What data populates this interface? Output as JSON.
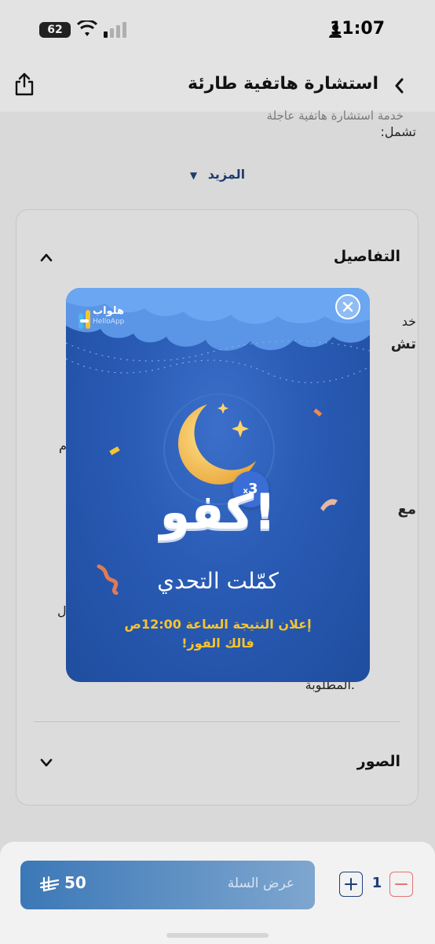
{
  "status_bar": {
    "time": "11:07",
    "battery": "62"
  },
  "header": {
    "title": "استشارة هاتفية طارئة"
  },
  "description": {
    "cut_line": "خدمة استشارة هاتفية عاجلة",
    "tail": "تشمل:"
  },
  "more": {
    "label": "المزيد"
  },
  "details": {
    "title": "التفاصيل",
    "fragments": [
      "خد",
      "تش",
      "م",
      "مع",
      "ل",
      "المطلوبة."
    ]
  },
  "photos": {
    "title": "الصور"
  },
  "popup": {
    "brand_ar": "هلواب",
    "brand_en": "HelloApp",
    "multiplier": "3",
    "multiplier_suffix": "x",
    "headline": "!كفو",
    "subhead": "كمّلت التحدي",
    "announce": "إعلان النتيجة الساعة 12:00ص",
    "luck": "فالك الفوز!"
  },
  "cart": {
    "label": "عرض السلة",
    "price": "50",
    "quantity": "1"
  },
  "colors": {
    "primary": "#1e3e77",
    "accent": "#f5c431",
    "popup_bg": "#2a5cb6",
    "minus": "#e47474"
  },
  "icons": [
    "share-icon",
    "chevron-left-icon",
    "chevron-down-icon",
    "chevron-up-icon",
    "close-icon",
    "plus-icon",
    "minus-icon",
    "riyal-icon",
    "wifi-icon",
    "signal-icon",
    "user-icon"
  ]
}
